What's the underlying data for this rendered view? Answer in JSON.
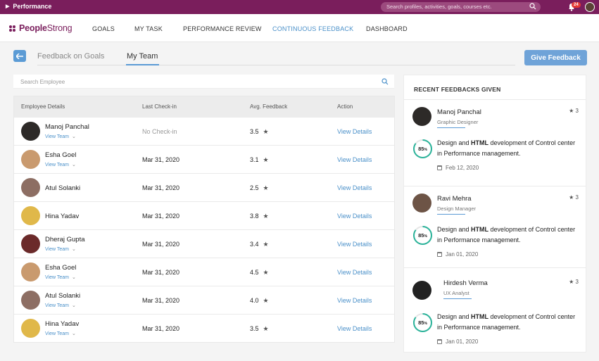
{
  "topbar": {
    "app_name": "Performance",
    "search_placeholder": "Search profiles, activities, goals, courses etc.",
    "notification_count": "24"
  },
  "brand": {
    "name_bold": "People",
    "name_rest": "Strong"
  },
  "nav": [
    {
      "label": "GOALS",
      "active": false
    },
    {
      "label": "MY TASK",
      "active": false
    },
    {
      "label": "PERFORMANCE REVIEW",
      "active": false
    },
    {
      "label": "CONTINUOUS FEEDBACK",
      "active": true
    },
    {
      "label": "DASHBOARD",
      "active": false
    }
  ],
  "subtabs": [
    {
      "label": "Feedback on Goals",
      "active": false
    },
    {
      "label": "My Team",
      "active": true
    }
  ],
  "give_feedback_label": "Give Feedback",
  "employee_search_placeholder": "Search Employee",
  "table": {
    "headers": [
      "Employee Details",
      "Last Check-in",
      "Avg. Feedback",
      "Action"
    ],
    "view_team_label": "View Team",
    "action_label": "View Details",
    "rows": [
      {
        "name": "Manoj Panchal",
        "show_view_team": true,
        "checkin": "No Check-in",
        "rating": "3.5",
        "avatar_color": "#2d2a28"
      },
      {
        "name": "Esha Goel",
        "show_view_team": true,
        "checkin": "Mar 31, 2020",
        "rating": "3.1",
        "avatar_color": "#c99a6e"
      },
      {
        "name": "Atul Solanki",
        "show_view_team": false,
        "checkin": "Mar 31, 2020",
        "rating": "2.5",
        "avatar_color": "#8d6e63"
      },
      {
        "name": "Hina Yadav",
        "show_view_team": false,
        "checkin": "Mar 31, 2020",
        "rating": "3.8",
        "avatar_color": "#e0b84a"
      },
      {
        "name": "Dheraj Gupta",
        "show_view_team": true,
        "checkin": "Mar 31, 2020",
        "rating": "3.4",
        "avatar_color": "#6b2a2a"
      },
      {
        "name": "Esha Goel",
        "show_view_team": true,
        "checkin": "Mar 31, 2020",
        "rating": "4.5",
        "avatar_color": "#c99a6e"
      },
      {
        "name": "Atul Solanki",
        "show_view_team": true,
        "checkin": "Mar 31, 2020",
        "rating": "4.0",
        "avatar_color": "#8d6e63"
      },
      {
        "name": "Hina Yadav",
        "show_view_team": true,
        "checkin": "Mar 31, 2020",
        "rating": "3.5",
        "avatar_color": "#e0b84a"
      }
    ]
  },
  "recent": {
    "title": "RECENT FEEDBACKS GIVEN",
    "items": [
      {
        "name": "Manoj Panchal",
        "role": "Graphic Designer",
        "stars": "3",
        "percent": 85,
        "percent_label": "85",
        "desc_parts": [
          "Design and ",
          "HTML",
          " development of Control center in  Performance management."
        ],
        "date": "Feb 12, 2020",
        "avatar_color": "#2d2a28"
      },
      {
        "name": "Ravi Mehra",
        "role": "Design Manager",
        "stars": "3",
        "percent": 85,
        "percent_label": "85",
        "desc_parts": [
          "Design and ",
          "HTML",
          " development of Control center in  Performance management."
        ],
        "date": "Jan 01, 2020",
        "avatar_color": "#6d5446"
      },
      {
        "name": "Hirdesh Verma",
        "role": "UX Analyst",
        "stars": "3",
        "percent": 85,
        "percent_label": "85",
        "desc_parts": [
          "Design and ",
          "HTML",
          " development of Control center in  Performance management."
        ],
        "date": "Jan 01, 2020",
        "avatar_color": "#222222"
      }
    ]
  },
  "colors": {
    "brand": "#7a1e5c",
    "accent": "#4a90c9",
    "ring": "#2bb39a"
  },
  "icons": [
    "back-arrow-icon",
    "search-icon",
    "bell-icon",
    "star-icon",
    "calendar-icon",
    "chevron-down-icon"
  ]
}
